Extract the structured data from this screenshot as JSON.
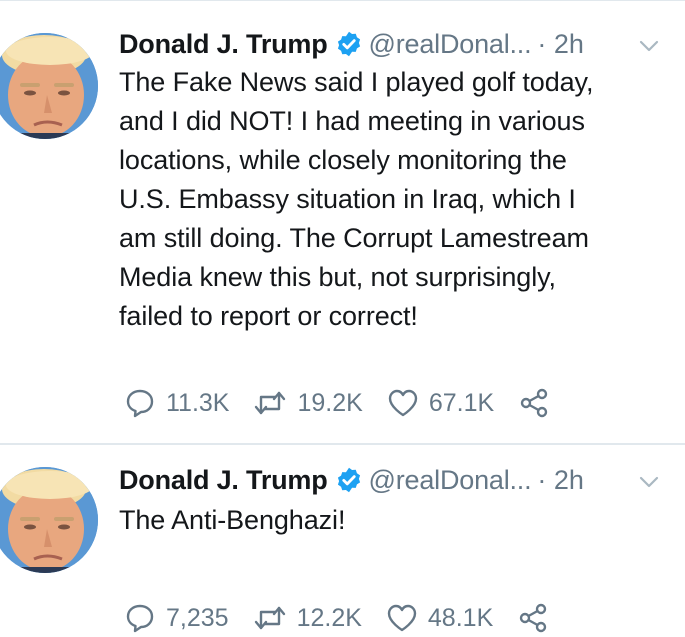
{
  "colors": {
    "text": "#14171a",
    "secondary": "#657786",
    "verified": "#1da1f2",
    "divider": "#e1e8ed"
  },
  "icons": [
    "avatar",
    "verified-badge-icon",
    "chevron-down-icon",
    "reply-icon",
    "retweet-icon",
    "like-icon",
    "share-icon"
  ],
  "tweets": [
    {
      "name": "Donald J. Trump",
      "handle": "@realDonal...",
      "time": "· 2h",
      "text": "The Fake News said I played golf today,\nand I did NOT! I had meeting in various\nlocations, while closely monitoring the\nU.S. Embassy situation in Iraq, which I\nam still doing. The Corrupt Lamestream\nMedia knew this but, not surprisingly,\nfailed to report or correct!",
      "replies": "11.3K",
      "retweets": "19.2K",
      "likes": "67.1K"
    },
    {
      "name": "Donald J. Trump",
      "handle": "@realDonal...",
      "time": "· 2h",
      "text": "The Anti-Benghazi!",
      "replies": "7,235",
      "retweets": "12.2K",
      "likes": "48.1K"
    }
  ]
}
